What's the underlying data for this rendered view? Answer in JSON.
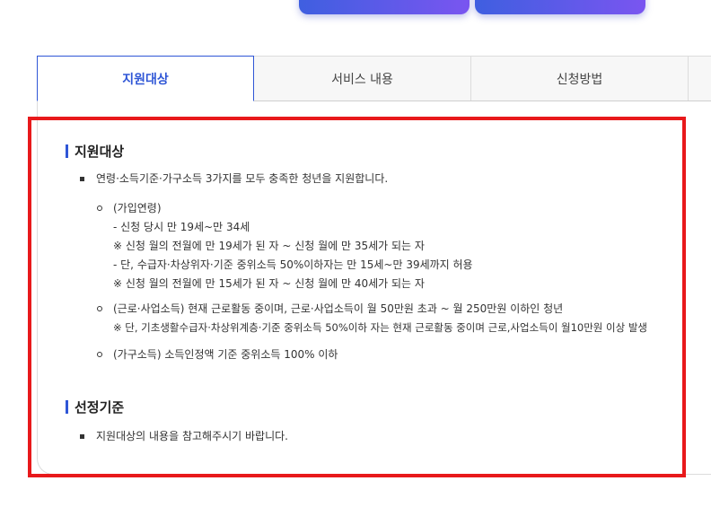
{
  "tabs": [
    {
      "label": "지원대상"
    },
    {
      "label": "서비스 내용"
    },
    {
      "label": "신청방법"
    }
  ],
  "section1": {
    "title": "지원대상",
    "bullet": "연령·소득기준·가구소득 3가지를 모두 충족한 청년을 지원합니다.",
    "items": [
      {
        "lines": [
          "(가입연령)",
          "- 신청 당시 만 19세~만 34세",
          "※ 신청 월의 전월에 만 19세가 된 자 ~ 신청 월에 만 35세가 되는 자",
          "- 단, 수급자·차상위자·기준 중위소득 50%이하자는 만 15세~만 39세까지 허용",
          "※ 신청 월의 전월에 만 15세가 된 자 ~ 신청 월에 만 40세가 되는 자"
        ]
      },
      {
        "lines": [
          "(근로·사업소득) 현재 근로활동 중이며, 근로·사업소득이 월 50만원 초과 ~ 월 250만원 이하인 청년",
          "※ 단, 기초생활수급자·차상위계층·기준 중위소득 50%이하 자는 현재 근로활동 중이며 근로,사업소득이 월10만원 이상 발생"
        ]
      },
      {
        "lines": [
          "(가구소득) 소득인정액 기준 중위소득 100% 이하"
        ]
      }
    ]
  },
  "section2": {
    "title": "선정기준",
    "bullet": "지원대상의 내용을 참고해주시기 바랍니다."
  }
}
